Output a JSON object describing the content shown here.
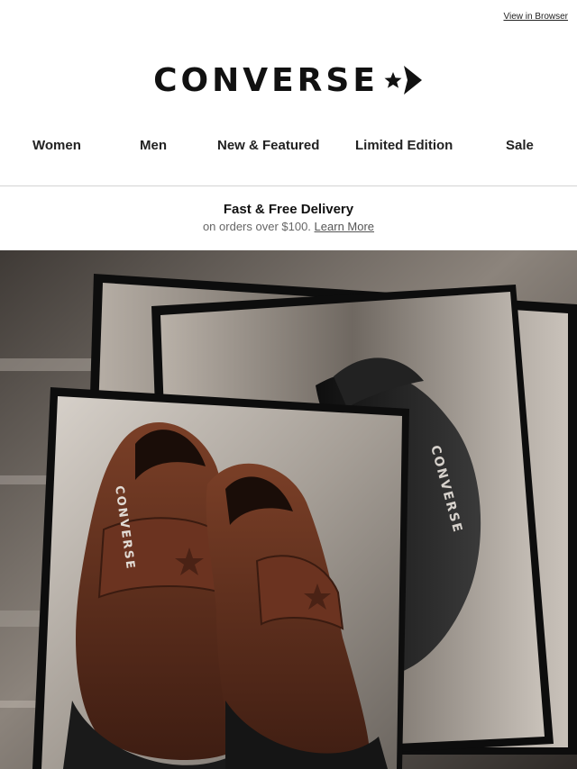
{
  "header": {
    "view_in_browser": "View in Browser",
    "brand": "CONVERSE"
  },
  "nav": {
    "items": [
      {
        "label": "Women"
      },
      {
        "label": "Men"
      },
      {
        "label": "New & Featured"
      },
      {
        "label": "Limited Edition"
      },
      {
        "label": "Sale"
      }
    ]
  },
  "promo": {
    "title": "Fast & Free Delivery",
    "subtitle": "on orders over $100.",
    "link": "Learn More"
  },
  "hero": {
    "shoe_text_left": "CONVERSE",
    "shoe_text_right": "CONVERSE",
    "colors": {
      "background": "#5e5853",
      "brown_leather": "#5a2d1c",
      "black_leather": "#1c1c1c",
      "frame": "#0d0d0d"
    }
  }
}
